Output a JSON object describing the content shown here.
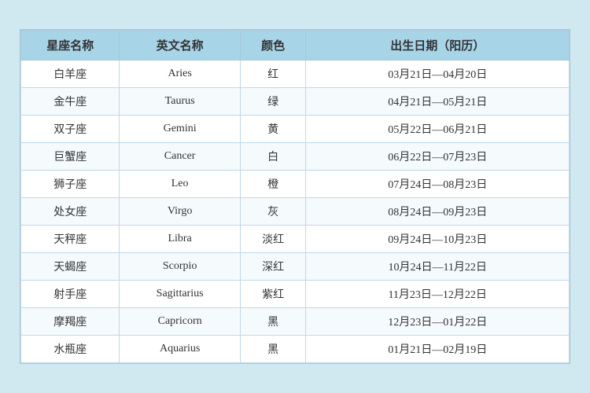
{
  "table": {
    "headers": {
      "chinese_name": "星座名称",
      "english_name": "英文名称",
      "color": "颜色",
      "birthday": "出生日期（阳历）"
    },
    "rows": [
      {
        "chinese": "白羊座",
        "english": "Aries",
        "color": "红",
        "dates": "03月21日—04月20日"
      },
      {
        "chinese": "金牛座",
        "english": "Taurus",
        "color": "绿",
        "dates": "04月21日—05月21日"
      },
      {
        "chinese": "双子座",
        "english": "Gemini",
        "color": "黄",
        "dates": "05月22日—06月21日"
      },
      {
        "chinese": "巨蟹座",
        "english": "Cancer",
        "color": "白",
        "dates": "06月22日—07月23日"
      },
      {
        "chinese": "狮子座",
        "english": "Leo",
        "color": "橙",
        "dates": "07月24日—08月23日"
      },
      {
        "chinese": "处女座",
        "english": "Virgo",
        "color": "灰",
        "dates": "08月24日—09月23日"
      },
      {
        "chinese": "天秤座",
        "english": "Libra",
        "color": "淡红",
        "dates": "09月24日—10月23日"
      },
      {
        "chinese": "天蝎座",
        "english": "Scorpio",
        "color": "深红",
        "dates": "10月24日—11月22日"
      },
      {
        "chinese": "射手座",
        "english": "Sagittarius",
        "color": "紫红",
        "dates": "11月23日—12月22日"
      },
      {
        "chinese": "摩羯座",
        "english": "Capricorn",
        "color": "黑",
        "dates": "12月23日—01月22日"
      },
      {
        "chinese": "水瓶座",
        "english": "Aquarius",
        "color": "黑",
        "dates": "01月21日—02月19日"
      }
    ]
  }
}
